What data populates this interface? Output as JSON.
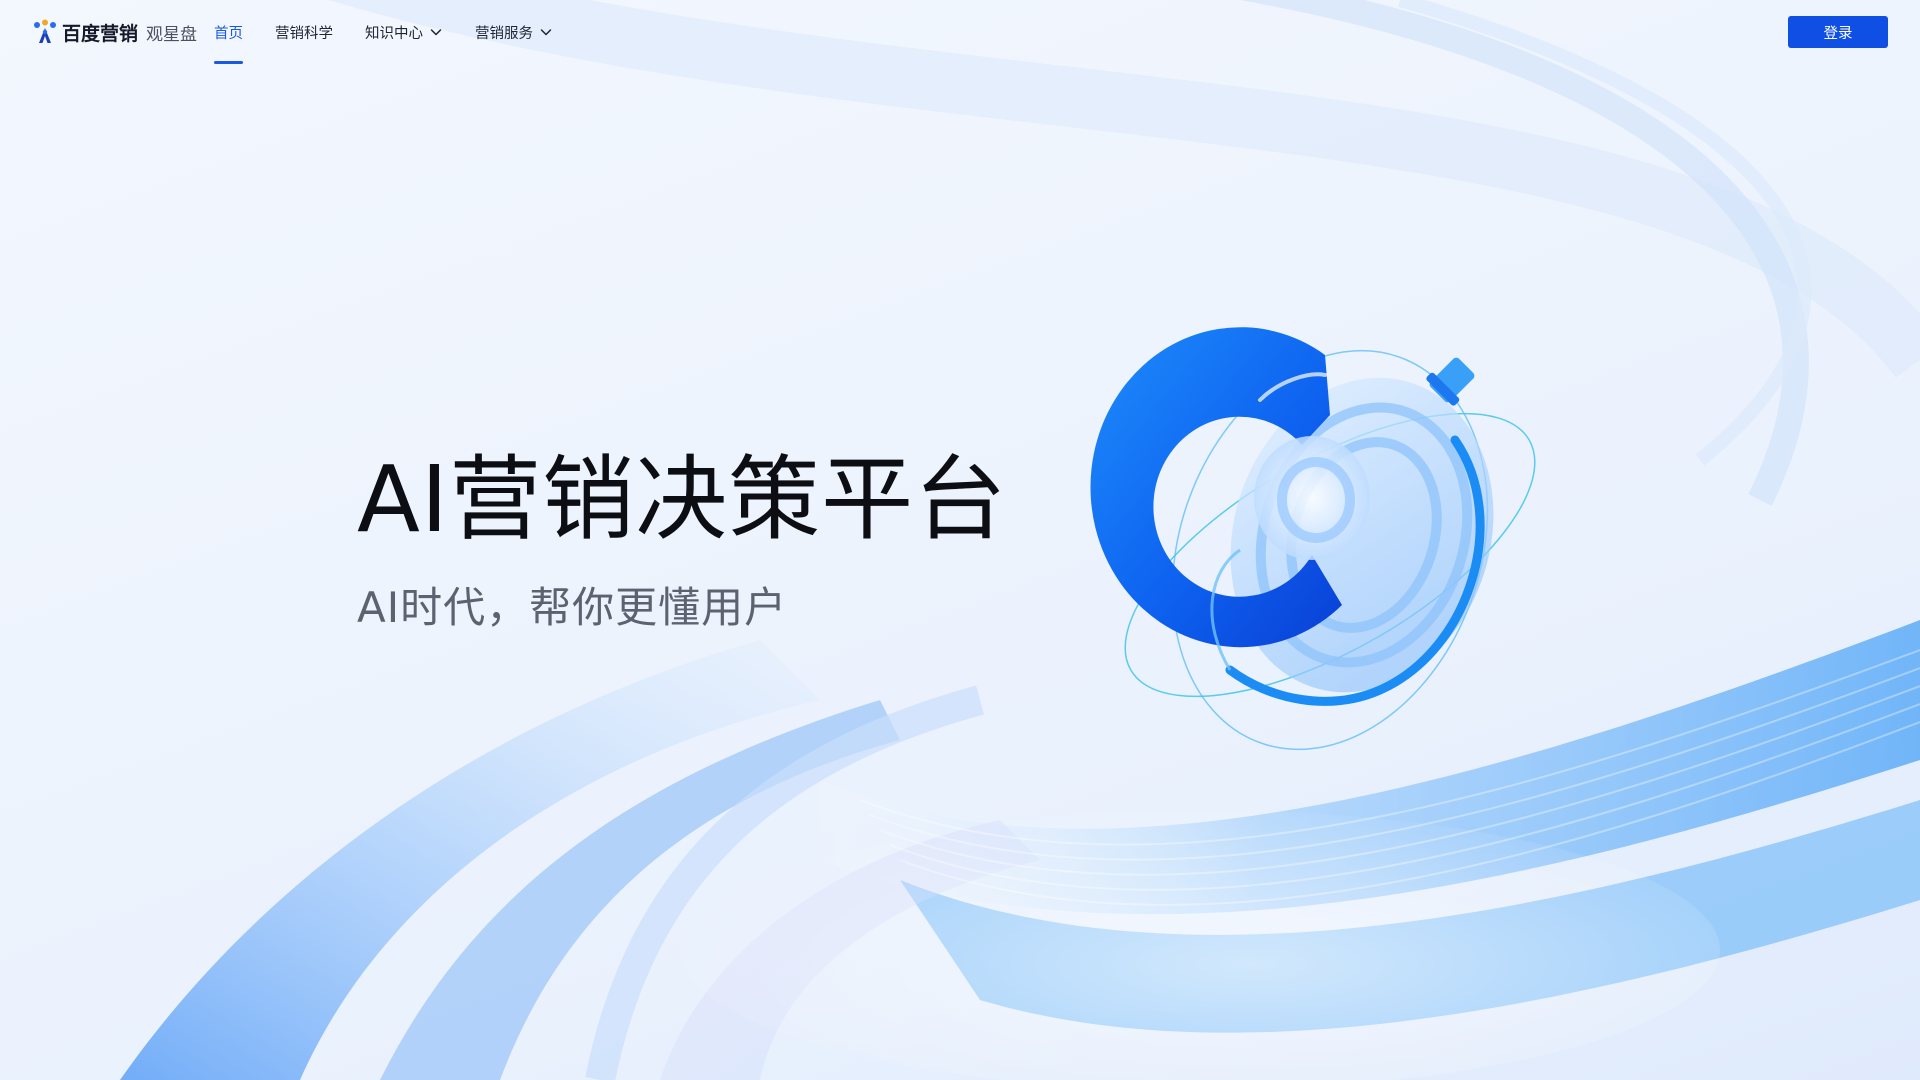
{
  "brand": {
    "name": "百度营销",
    "product": "观星盘"
  },
  "nav": {
    "items": [
      {
        "label": "首页",
        "active": true,
        "has_dropdown": false
      },
      {
        "label": "营销科学",
        "active": false,
        "has_dropdown": false
      },
      {
        "label": "知识中心",
        "active": false,
        "has_dropdown": true
      },
      {
        "label": "营销服务",
        "active": false,
        "has_dropdown": true
      }
    ],
    "dropdown_icon": "chevron-down-icon"
  },
  "header": {
    "login_label": "登录"
  },
  "hero": {
    "title": "AI营销决策平台",
    "subtitle": "AI时代，帮你更懂用户"
  },
  "colors": {
    "accent": "#1a58e8",
    "login_button": "#0f4fe3",
    "title_text": "#0c0e14",
    "subtitle_text": "#5c6270",
    "background": "#eef4fd"
  }
}
